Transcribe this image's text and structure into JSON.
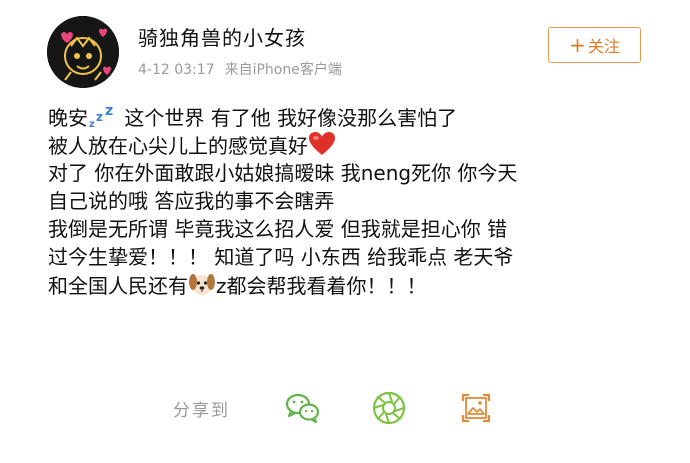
{
  "post": {
    "username": "骑独角兽的小女孩",
    "date": "4-12 03:17",
    "source": "来自iPhone客户端",
    "follow_label": "关注",
    "follow_prefix": "+",
    "lines": [
      {
        "before": "晚安",
        "zzz": "zzz",
        "after": " 这个世界 有了他 我好像没那么害怕了"
      },
      {
        "text": "被人放在心尖儿上的感觉真好",
        "emoji": "red-heart-emoji"
      },
      {
        "text": "对了 你在外面敢跟小姑娘搞暧昧 我neng死你 你今天"
      },
      {
        "text": "自己说的哦 答应我的事不会瞎弄"
      },
      {
        "text": "我倒是无所谓 毕竟我这么招人爱  但我就是担心你 错"
      },
      {
        "text": "过今生挚爱！！！ 知道了吗 小东西 给我乖点 老天爷"
      },
      {
        "before": "和全国人民还有",
        "emoji": "dog-face-emoji",
        "after": "z都会帮我看着你！！！"
      }
    ]
  },
  "share": {
    "label": "分享到",
    "targets": [
      {
        "name": "wechat-icon",
        "color": "#62b34a"
      },
      {
        "name": "moments-icon",
        "color": "#7cc243"
      },
      {
        "name": "screenshot-share-icon",
        "color": "#e08a3a"
      }
    ]
  },
  "colors": {
    "accent": "#e07a25",
    "meta_text": "#9a9a9a",
    "heart": "#e0302a"
  }
}
